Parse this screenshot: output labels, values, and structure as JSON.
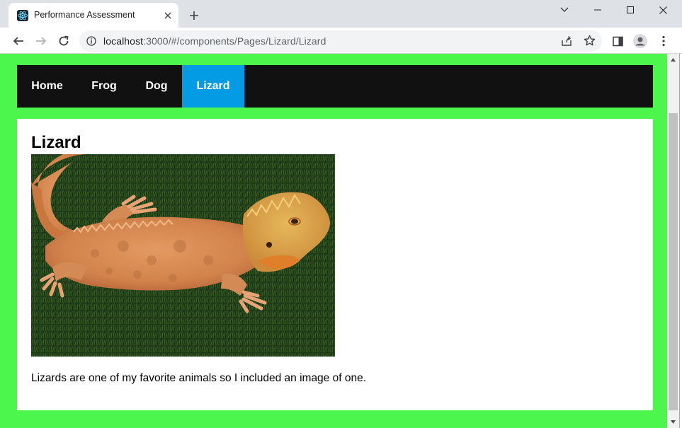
{
  "browser": {
    "tab_title": "Performance Assessment",
    "url_host": "localhost",
    "url_rest": ":3000/#/components/Pages/Lizard/Lizard"
  },
  "nav": {
    "items": [
      {
        "label": "Home",
        "active": false
      },
      {
        "label": "Frog",
        "active": false
      },
      {
        "label": "Dog",
        "active": false
      },
      {
        "label": "Lizard",
        "active": true
      }
    ]
  },
  "page": {
    "heading": "Lizard",
    "image_subject": "bearded dragon lizard on artificial grass",
    "description": "Lizards are one of my favorite animals so I included an image of one."
  },
  "colors": {
    "page_background": "#4cf64c",
    "navbar": "#111111",
    "nav_active": "#049be5"
  }
}
